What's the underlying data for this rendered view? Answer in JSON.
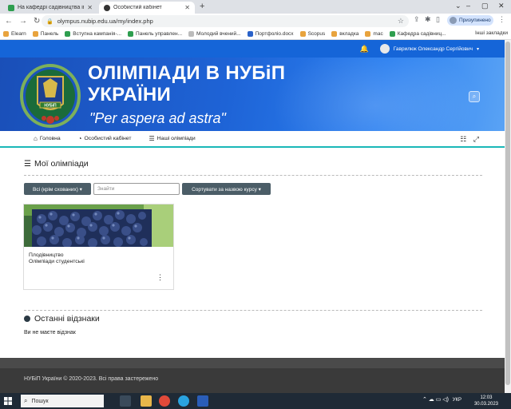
{
  "browser": {
    "tabs": [
      {
        "title": "На кафедрі садівництва ім. проф",
        "active": false
      },
      {
        "title": "Особистий кабінет",
        "active": true
      }
    ],
    "new_tab": "+",
    "url": "olympus.nubip.edu.ua/my/index.php",
    "profile_status": "Призупинено",
    "bookmarks": [
      "Elearn",
      "Панель",
      "Вступна кампанія-...",
      "Панель управлен...",
      "Молодий вчений...",
      "Портфоліо.docx",
      "Scopus",
      "вкладка",
      "mac",
      "Кафедра садівниц..."
    ],
    "bookmarks_more": "Інші закладки"
  },
  "site": {
    "user_name": "Гаврилюк Олександр Сергійович",
    "banner_title_line1": "ОЛІМПІАДИ В НУБіП",
    "banner_title_line2": "УКРАЇНИ",
    "banner_motto": "\"Per aspera ad astra\"",
    "emblem_text": "НУБіП",
    "menu": [
      {
        "label": "Головна",
        "icon": "home-icon"
      },
      {
        "label": "Особистий кабінет",
        "icon": "dashboard-icon"
      },
      {
        "label": "Наші олімпіади",
        "icon": "list-icon"
      }
    ]
  },
  "main": {
    "section_title": "Мої олімпіади",
    "filter_label": "Всі (крім схованих) ▾",
    "search_placeholder": "Знайти",
    "sort_label": "Сортувати за назвою курсу ▾",
    "course": {
      "category": "Плодівництво",
      "name": "Олімпіади студентські",
      "menu": "⋮"
    },
    "badges_title": "Останні відзнаки",
    "no_badges": "Ви не маєте відзнак"
  },
  "footer": {
    "copyright": "НУБіП України © 2020-2023. Всі права застережено"
  },
  "taskbar": {
    "search_label": "Пошук",
    "lang": "УКР",
    "time": "12:03",
    "date": "30.03.2023"
  },
  "colors": {
    "brand_blue": "#1565d8",
    "accent_teal": "#1ab8b8",
    "button_gray": "#4b5d67",
    "footer": "#3a3a3a"
  }
}
